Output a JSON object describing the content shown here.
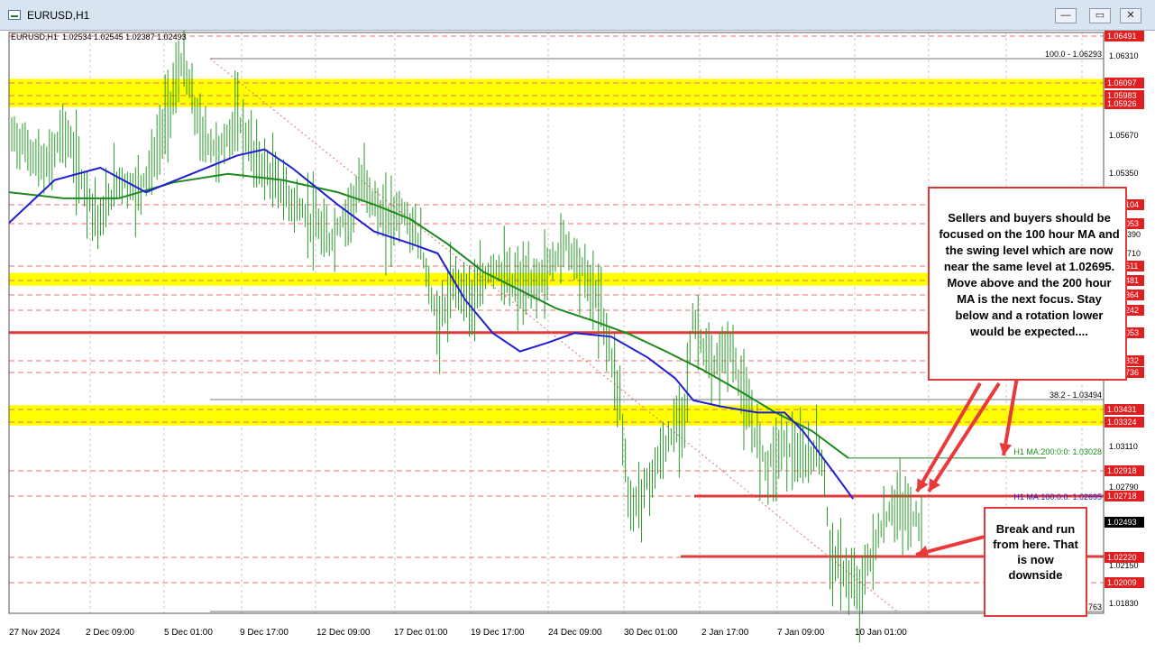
{
  "window": {
    "title": "EURUSD,H1",
    "min_glyph": "—",
    "restore_glyph": "▭",
    "close_glyph": "✕"
  },
  "header": {
    "ohlc_text": "EURUSD,H1  1.02534 1.02545 1.02387 1.02493"
  },
  "price_axis": {
    "grid_ticks": [
      "1.06310",
      "1.05670",
      "1.05350",
      "1.03110",
      "1.02790",
      "1.02150",
      "1.01830"
    ],
    "partial_ticks": [
      "710",
      "390"
    ],
    "boxed_levels": [
      {
        "text": "1.06491",
        "color": "#e02020"
      },
      {
        "text": "1.06097",
        "color": "#e02020"
      },
      {
        "text": "1.05983",
        "color": "#e02020"
      },
      {
        "text": "1.05926",
        "color": "#e02020"
      },
      {
        "text": "104",
        "color": "#e02020"
      },
      {
        "text": "053",
        "color": "#e02020"
      },
      {
        "text": "511",
        "color": "#e02020"
      },
      {
        "text": "481",
        "color": "#e02020"
      },
      {
        "text": "364",
        "color": "#e02020"
      },
      {
        "text": "242",
        "color": "#e02020"
      },
      {
        "text": "053",
        "color": "#e02020"
      },
      {
        "text": "832",
        "color": "#e02020"
      },
      {
        "text": "736",
        "color": "#e02020"
      },
      {
        "text": "1.03431",
        "color": "#e02020"
      },
      {
        "text": "1.03324",
        "color": "#e02020"
      },
      {
        "text": "1.02918",
        "color": "#e02020"
      },
      {
        "text": "1.02718",
        "color": "#e02020"
      },
      {
        "text": "1.02493",
        "color": "#000000"
      },
      {
        "text": "1.02220",
        "color": "#e02020"
      },
      {
        "text": "1.02009",
        "color": "#e02020"
      }
    ]
  },
  "time_axis": {
    "labels": [
      "27 Nov 2024",
      "2 Dec 09:00",
      "5 Dec 01:00",
      "9 Dec 17:00",
      "12 Dec 09:00",
      "17 Dec 01:00",
      "19 Dec 17:00",
      "24 Dec 09:00",
      "30 Dec 01:00",
      "2 Jan 17:00",
      "7 Jan 09:00",
      "10 Jan 01:00"
    ]
  },
  "fib_labels": {
    "top": "100.0 - 1.06293",
    "mid": "38.2 - 1.03494",
    "bottom": "763"
  },
  "ma_labels": {
    "ma200": "H1 MA:200:0:0: 1.03028",
    "ma100": "H1 MA:100:0:0: 1.02695"
  },
  "callouts": {
    "main": "Sellers and buyers should be focused on the 100 hour MA and the swing level which are now near the same level at 1.02695. Move above and the 200 hour MA is the next focus. Stay below and a rotation lower would be expected....",
    "break": "Break and run from here. That is now downside"
  },
  "colors": {
    "candle": "#2a9a2a",
    "ma100": "#2020d0",
    "ma200": "#1e8a1e",
    "zone": "#ffff00",
    "level": "#e03a3a",
    "annotation": "#e83a3a",
    "titlebar": "#d9e4f1"
  },
  "chart_data": {
    "type": "line",
    "symbol": "EURUSD",
    "timeframe": "H1",
    "ohlc": {
      "open": 1.02534,
      "high": 1.02545,
      "low": 1.02387,
      "close": 1.02493
    },
    "x_labels": [
      "27 Nov 2024",
      "2 Dec 09:00",
      "5 Dec 01:00",
      "9 Dec 17:00",
      "12 Dec 09:00",
      "17 Dec 01:00",
      "19 Dec 17:00",
      "24 Dec 09:00",
      "30 Dec 01:00",
      "2 Jan 17:00",
      "7 Jan 09:00",
      "10 Jan 01:00"
    ],
    "ylim": [
      1.0176,
      1.0652
    ],
    "price_path": [
      [
        0,
        1.057
      ],
      [
        0.02,
        1.0555
      ],
      [
        0.04,
        1.0538
      ],
      [
        0.06,
        1.0572
      ],
      [
        0.08,
        1.053
      ],
      [
        0.1,
        1.0495
      ],
      [
        0.12,
        1.0532
      ],
      [
        0.14,
        1.052
      ],
      [
        0.16,
        1.0548
      ],
      [
        0.17,
        1.0575
      ],
      [
        0.19,
        1.0628
      ],
      [
        0.21,
        1.0568
      ],
      [
        0.23,
        1.0552
      ],
      [
        0.25,
        1.058
      ],
      [
        0.27,
        1.0548
      ],
      [
        0.29,
        1.053
      ],
      [
        0.31,
        1.0512
      ],
      [
        0.33,
        1.0498
      ],
      [
        0.35,
        1.0478
      ],
      [
        0.37,
        1.0502
      ],
      [
        0.39,
        1.053
      ],
      [
        0.41,
        1.0495
      ],
      [
        0.43,
        1.0505
      ],
      [
        0.45,
        1.048
      ],
      [
        0.47,
        1.041
      ],
      [
        0.49,
        1.0448
      ],
      [
        0.51,
        1.043
      ],
      [
        0.53,
        1.0462
      ],
      [
        0.55,
        1.0445
      ],
      [
        0.57,
        1.0442
      ],
      [
        0.59,
        1.0455
      ],
      [
        0.61,
        1.048
      ],
      [
        0.63,
        1.0455
      ],
      [
        0.65,
        1.0422
      ],
      [
        0.67,
        1.035
      ],
      [
        0.68,
        1.0258
      ],
      [
        0.7,
        1.0282
      ],
      [
        0.72,
        1.0312
      ],
      [
        0.74,
        1.0342
      ],
      [
        0.75,
        1.0418
      ],
      [
        0.77,
        1.0372
      ],
      [
        0.79,
        1.0395
      ],
      [
        0.81,
        1.0338
      ],
      [
        0.83,
        1.0298
      ],
      [
        0.85,
        1.0315
      ],
      [
        0.87,
        1.0298
      ],
      [
        0.89,
        1.0312
      ],
      [
        0.9,
        1.0225
      ],
      [
        0.92,
        1.0205
      ],
      [
        0.93,
        1.019
      ],
      [
        0.95,
        1.0235
      ],
      [
        0.97,
        1.0265
      ],
      [
        1.0,
        1.0249
      ]
    ],
    "series": [
      {
        "name": "H1 MA:100:0:0",
        "last": 1.02695
      },
      {
        "name": "H1 MA:200:0:0",
        "last": 1.03028
      }
    ],
    "ma100_path": [
      [
        0,
        1.0495
      ],
      [
        0.05,
        1.053
      ],
      [
        0.1,
        1.054
      ],
      [
        0.15,
        1.052
      ],
      [
        0.2,
        1.0535
      ],
      [
        0.25,
        1.055
      ],
      [
        0.28,
        1.0555
      ],
      [
        0.31,
        1.054
      ],
      [
        0.36,
        1.051
      ],
      [
        0.4,
        1.0488
      ],
      [
        0.44,
        1.0478
      ],
      [
        0.47,
        1.047
      ],
      [
        0.5,
        1.0432
      ],
      [
        0.53,
        1.0405
      ],
      [
        0.56,
        1.039
      ],
      [
        0.59,
        1.0397
      ],
      [
        0.62,
        1.0405
      ],
      [
        0.66,
        1.0402
      ],
      [
        0.7,
        1.0385
      ],
      [
        0.73,
        1.0368
      ],
      [
        0.75,
        1.035
      ],
      [
        0.78,
        1.0345
      ],
      [
        0.82,
        1.034
      ],
      [
        0.85,
        1.034
      ],
      [
        0.87,
        1.0325
      ],
      [
        0.89,
        1.0305
      ],
      [
        0.91,
        1.0285
      ],
      [
        0.925,
        1.02695
      ]
    ],
    "ma200_path": [
      [
        0,
        1.052
      ],
      [
        0.06,
        1.0515
      ],
      [
        0.12,
        1.0515
      ],
      [
        0.18,
        1.0528
      ],
      [
        0.24,
        1.0535
      ],
      [
        0.3,
        1.053
      ],
      [
        0.36,
        1.052
      ],
      [
        0.4,
        1.051
      ],
      [
        0.44,
        1.0498
      ],
      [
        0.48,
        1.0478
      ],
      [
        0.52,
        1.0455
      ],
      [
        0.56,
        1.044
      ],
      [
        0.6,
        1.0425
      ],
      [
        0.64,
        1.0415
      ],
      [
        0.68,
        1.0404
      ],
      [
        0.72,
        1.039
      ],
      [
        0.76,
        1.0375
      ],
      [
        0.8,
        1.0358
      ],
      [
        0.84,
        1.034
      ],
      [
        0.88,
        1.0325
      ],
      [
        0.92,
        1.03028
      ]
    ],
    "zones": [
      [
        1.05926,
        1.06097
      ],
      [
        1.04481,
        1.04511
      ],
      [
        1.03324,
        1.03431
      ]
    ],
    "horizontal_levels": [
      1.04053,
      1.02718,
      1.0222
    ]
  }
}
